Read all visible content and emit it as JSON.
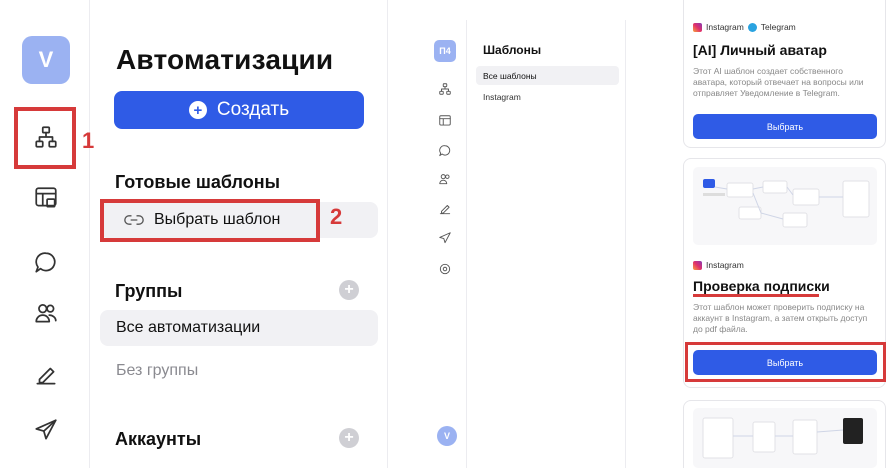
{
  "left_panel": {
    "avatar": "V",
    "section_title": "Автоматизации",
    "create_label": "Создать",
    "templates_heading": "Готовые шаблоны",
    "choose_template": "Выбрать шаблон",
    "groups_heading": "Группы",
    "all_automations": "Все автоматизации",
    "no_group": "Без группы",
    "accounts_heading": "Аккаунты",
    "step1": "1",
    "step2": "2",
    "rail_icons": [
      "automation-icon",
      "dashboard-icon",
      "chat-icon",
      "users-icon",
      "pen-icon",
      "send-icon"
    ],
    "accent": "#2f5be6",
    "highlight": "#d63a3a"
  },
  "middle_panel": {
    "avatar": "П4",
    "title": "Шаблоны",
    "items": [
      "Все шаблоны",
      "Instagram"
    ],
    "bottom_avatar": "V"
  },
  "cards": [
    {
      "tags": [
        "Instagram",
        "Telegram"
      ],
      "title": "[AI] Личный аватар",
      "desc": "Этот AI шаблон создает собственного аватара, который отвечает на вопросы или отправляет Уведомление в Telegram.",
      "button": "Выбрать"
    },
    {
      "tags": [
        "Instagram"
      ],
      "title": "Проверка подписки",
      "desc": "Этот шаблон может проверить подписку на аккаунт в Instagram, а затем открыть доступ до pdf файла.",
      "button": "Выбрать"
    }
  ]
}
